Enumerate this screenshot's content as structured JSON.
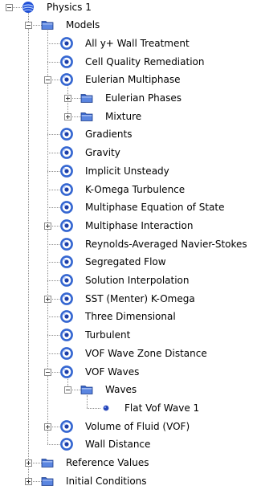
{
  "tree": {
    "nodes": [
      {
        "label": "Physics 1",
        "depth": 0,
        "icon": "physics-continuum-icon",
        "toggle": "minus"
      },
      {
        "label": "Models",
        "depth": 1,
        "icon": "folder-icon",
        "toggle": "minus"
      },
      {
        "label": "All y+ Wall Treatment",
        "depth": 2,
        "icon": "model-icon",
        "toggle": null
      },
      {
        "label": "Cell Quality Remediation",
        "depth": 2,
        "icon": "model-icon",
        "toggle": null
      },
      {
        "label": "Eulerian Multiphase",
        "depth": 2,
        "icon": "model-icon",
        "toggle": "minus"
      },
      {
        "label": "Eulerian Phases",
        "depth": 3,
        "icon": "folder-icon",
        "toggle": "plus"
      },
      {
        "label": "Mixture",
        "depth": 3,
        "icon": "folder-icon",
        "toggle": "plus"
      },
      {
        "label": "Gradients",
        "depth": 2,
        "icon": "model-icon",
        "toggle": null
      },
      {
        "label": "Gravity",
        "depth": 2,
        "icon": "model-icon",
        "toggle": null
      },
      {
        "label": "Implicit Unsteady",
        "depth": 2,
        "icon": "model-icon",
        "toggle": null
      },
      {
        "label": "K-Omega Turbulence",
        "depth": 2,
        "icon": "model-icon",
        "toggle": null
      },
      {
        "label": "Multiphase Equation of State",
        "depth": 2,
        "icon": "model-icon",
        "toggle": null
      },
      {
        "label": "Multiphase Interaction",
        "depth": 2,
        "icon": "model-icon",
        "toggle": "plus"
      },
      {
        "label": "Reynolds-Averaged Navier-Stokes",
        "depth": 2,
        "icon": "model-icon",
        "toggle": null
      },
      {
        "label": "Segregated Flow",
        "depth": 2,
        "icon": "model-icon",
        "toggle": null
      },
      {
        "label": "Solution Interpolation",
        "depth": 2,
        "icon": "model-icon",
        "toggle": null
      },
      {
        "label": "SST (Menter) K-Omega",
        "depth": 2,
        "icon": "model-icon",
        "toggle": "plus"
      },
      {
        "label": "Three Dimensional",
        "depth": 2,
        "icon": "model-icon",
        "toggle": null
      },
      {
        "label": "Turbulent",
        "depth": 2,
        "icon": "model-icon",
        "toggle": null
      },
      {
        "label": "VOF Wave Zone Distance",
        "depth": 2,
        "icon": "model-icon",
        "toggle": null
      },
      {
        "label": "VOF Waves",
        "depth": 2,
        "icon": "model-icon",
        "toggle": "minus"
      },
      {
        "label": "Waves",
        "depth": 3,
        "icon": "folder-icon",
        "toggle": "minus"
      },
      {
        "label": "Flat Vof Wave 1",
        "depth": 4,
        "icon": "bullet-icon",
        "toggle": null
      },
      {
        "label": "Volume of Fluid (VOF)",
        "depth": 2,
        "icon": "model-icon",
        "toggle": "plus"
      },
      {
        "label": "Wall Distance",
        "depth": 2,
        "icon": "model-icon",
        "toggle": null
      },
      {
        "label": "Reference Values",
        "depth": 1,
        "icon": "folder-icon",
        "toggle": "plus"
      },
      {
        "label": "Initial Conditions",
        "depth": 1,
        "icon": "folder-icon",
        "toggle": "plus"
      }
    ]
  },
  "colors": {
    "folder": "#3a66c9",
    "model_ring": "#3466d1",
    "sphere": "#1f4fd6",
    "connector": "#8c8c8c"
  }
}
